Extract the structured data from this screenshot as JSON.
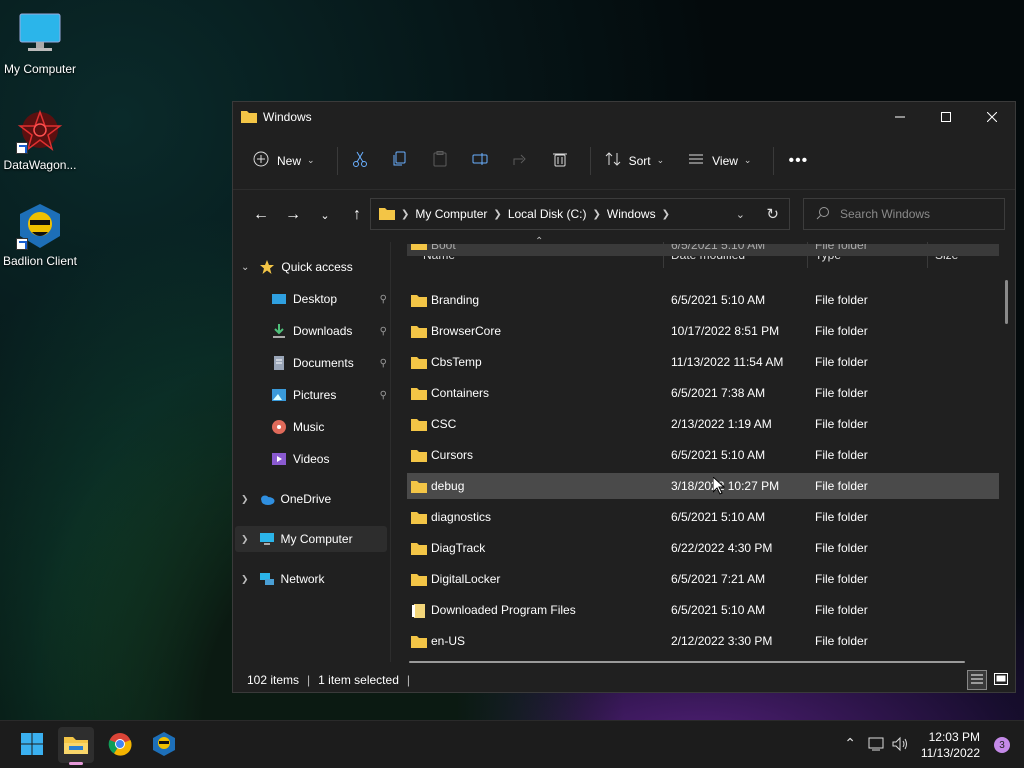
{
  "desktop": {
    "icons": [
      {
        "label": "My Computer"
      },
      {
        "label": "DataWagon..."
      },
      {
        "label": "Badlion Client"
      }
    ]
  },
  "window": {
    "title": "Windows",
    "toolbar": {
      "new_label": "New",
      "sort_label": "Sort",
      "view_label": "View"
    },
    "breadcrumb": [
      "My Computer",
      "Local Disk (C:)",
      "Windows"
    ],
    "search_placeholder": "Search Windows",
    "sidebar": {
      "quick_access": "Quick access",
      "items": [
        {
          "label": "Desktop",
          "pinned": true
        },
        {
          "label": "Downloads",
          "pinned": true
        },
        {
          "label": "Documents",
          "pinned": true
        },
        {
          "label": "Pictures",
          "pinned": true
        },
        {
          "label": "Music",
          "pinned": false
        },
        {
          "label": "Videos",
          "pinned": false
        }
      ],
      "onedrive": "OneDrive",
      "my_computer": "My Computer",
      "network": "Network"
    },
    "columns": {
      "name": "Name",
      "date": "Date modified",
      "type": "Type",
      "size": "Size"
    },
    "files": [
      {
        "name": "Boot",
        "date": "6/5/2021 5:10 AM",
        "type": "File folder"
      },
      {
        "name": "Branding",
        "date": "6/5/2021 5:10 AM",
        "type": "File folder"
      },
      {
        "name": "BrowserCore",
        "date": "10/17/2022 8:51 PM",
        "type": "File folder"
      },
      {
        "name": "CbsTemp",
        "date": "11/13/2022 11:54 AM",
        "type": "File folder"
      },
      {
        "name": "Containers",
        "date": "6/5/2021 7:38 AM",
        "type": "File folder"
      },
      {
        "name": "CSC",
        "date": "2/13/2022 1:19 AM",
        "type": "File folder"
      },
      {
        "name": "Cursors",
        "date": "6/5/2021 5:10 AM",
        "type": "File folder"
      },
      {
        "name": "debug",
        "date": "3/18/2022 10:27 PM",
        "type": "File folder"
      },
      {
        "name": "diagnostics",
        "date": "6/5/2021 5:10 AM",
        "type": "File folder"
      },
      {
        "name": "DiagTrack",
        "date": "6/22/2022 4:30 PM",
        "type": "File folder"
      },
      {
        "name": "DigitalLocker",
        "date": "6/5/2021 7:21 AM",
        "type": "File folder"
      },
      {
        "name": "Downloaded Program Files",
        "date": "6/5/2021 5:10 AM",
        "type": "File folder"
      },
      {
        "name": "en-US",
        "date": "2/12/2022 3:30 PM",
        "type": "File folder"
      }
    ],
    "status": {
      "items": "102 items",
      "selected": "1 item selected"
    }
  },
  "taskbar": {
    "time": "12:03 PM",
    "date": "11/13/2022",
    "notifications": "3"
  },
  "colors": {
    "folder": "#f3c546",
    "accent": "#4cc2ff"
  }
}
